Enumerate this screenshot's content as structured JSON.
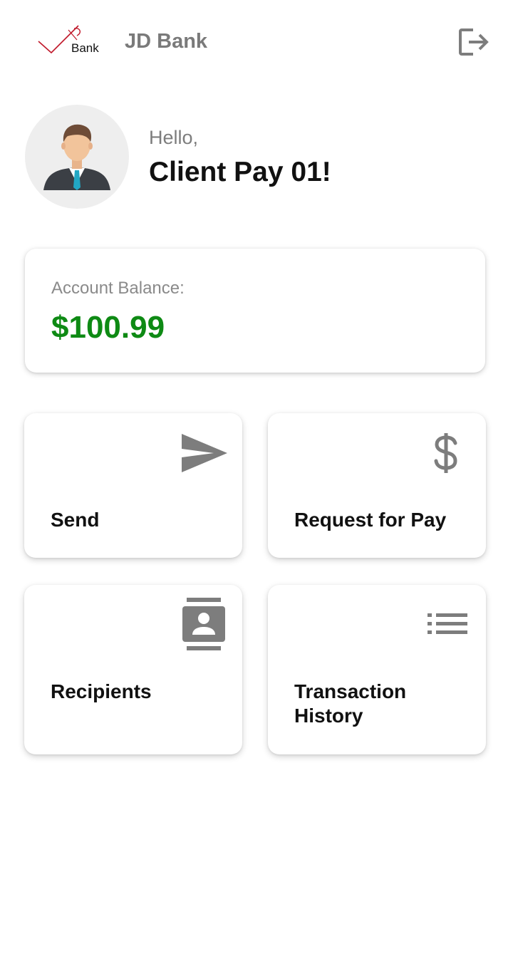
{
  "header": {
    "logo_text": "Bank",
    "bank_name": "JD Bank",
    "logout_icon": "logout-icon"
  },
  "greeting": {
    "hello": "Hello,",
    "name": "Client Pay 01!"
  },
  "balance": {
    "label": "Account Balance:",
    "value": "$100.99",
    "value_color": "#0e8a14"
  },
  "actions": [
    {
      "label": "Send",
      "icon": "send-icon"
    },
    {
      "label": "Request for Pay",
      "icon": "dollar-icon"
    },
    {
      "label": "Recipients",
      "icon": "contacts-icon"
    },
    {
      "label": "Transaction\nHistory",
      "icon": "list-icon"
    }
  ],
  "colors": {
    "icon_gray": "#7d7d7d",
    "brand_red": "#c0182a"
  }
}
